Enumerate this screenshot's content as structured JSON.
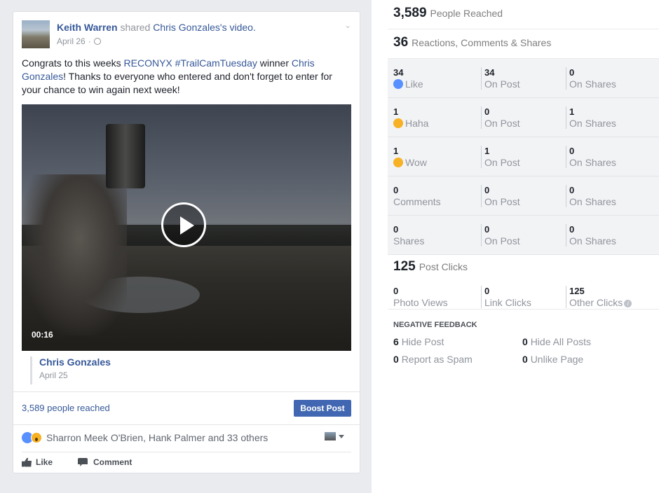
{
  "post": {
    "author": "Keith Warren",
    "shared_word": "shared",
    "shared_owner": "Chris Gonzales",
    "shared_suffix": "'s video.",
    "date": "April 26",
    "dot": "·",
    "text_1": "Congrats to this weeks ",
    "text_link_1": "RECONYX #TrailCamTuesday",
    "text_2": " winner ",
    "text_link_2": "Chris Gonzales",
    "text_3": "! Thanks to everyone who entered and don't forget to enter for your chance to win again next week!",
    "video_time": "00:16",
    "shared_name": "Chris Gonzales",
    "shared_date": "April 25",
    "reach": "3,589 people reached",
    "boost": "Boost Post",
    "reactors": "Sharron Meek O'Brien, Hank Palmer and 33 others",
    "like_label": "Like",
    "comment_label": "Comment"
  },
  "insights": {
    "reached_num": "3,589",
    "reached_label": "People Reached",
    "engage_num": "36",
    "engage_label": "Reactions, Comments & Shares",
    "rows": [
      {
        "a_num": "34",
        "a_label": "Like",
        "b_num": "34",
        "b_label": "On Post",
        "c_num": "0",
        "c_label": "On Shares"
      },
      {
        "a_num": "1",
        "a_label": "Haha",
        "b_num": "0",
        "b_label": "On Post",
        "c_num": "1",
        "c_label": "On Shares"
      },
      {
        "a_num": "1",
        "a_label": "Wow",
        "b_num": "1",
        "b_label": "On Post",
        "c_num": "0",
        "c_label": "On Shares"
      },
      {
        "a_num": "0",
        "a_label": "Comments",
        "b_num": "0",
        "b_label": "On Post",
        "c_num": "0",
        "c_label": "On Shares"
      },
      {
        "a_num": "0",
        "a_label": "Shares",
        "b_num": "0",
        "b_label": "On Post",
        "c_num": "0",
        "c_label": "On Shares"
      }
    ],
    "clicks_num": "125",
    "clicks_label": "Post Clicks",
    "clicks": [
      {
        "num": "0",
        "label": "Photo Views"
      },
      {
        "num": "0",
        "label": "Link Clicks"
      },
      {
        "num": "125",
        "label": "Other Clicks"
      }
    ],
    "neg_head": "NEGATIVE FEEDBACK",
    "neg": [
      {
        "num": "6",
        "label": "Hide Post"
      },
      {
        "num": "0",
        "label": "Hide All Posts"
      },
      {
        "num": "0",
        "label": "Report as Spam"
      },
      {
        "num": "0",
        "label": "Unlike Page"
      }
    ]
  },
  "icons": {
    "info": "i",
    "like_badge": "👍"
  }
}
